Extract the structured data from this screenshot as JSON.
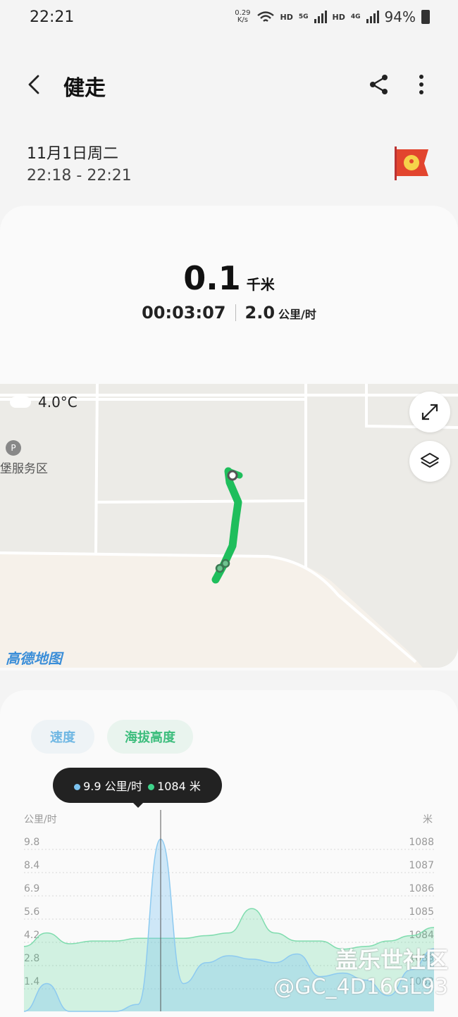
{
  "status": {
    "time": "22:21",
    "net_speed": "0.29",
    "net_unit": "K/s",
    "hd1": "HD",
    "gen1": "5G",
    "hd2": "HD",
    "gen2": "4G",
    "battery": "94%"
  },
  "header": {
    "title": "健走"
  },
  "workout": {
    "date": "11月1日周二",
    "time_range": "22:18 - 22:21",
    "distance": "0.1",
    "distance_unit": "千米",
    "duration": "00:03:07",
    "speed": "2.0",
    "speed_unit": "公里/时"
  },
  "map": {
    "temperature": "4.0°C",
    "poi": "堡服务区",
    "provider": "高德地图"
  },
  "chart_tabs": {
    "speed": "速度",
    "altitude": "海拔高度"
  },
  "tooltip": {
    "speed": "9.9 公里/时",
    "altitude": "1084 米"
  },
  "colors": {
    "speed": "#7cc3f0",
    "altitude": "#3ed38a",
    "route": "#1fbe5c"
  },
  "chart_data": {
    "type": "area",
    "left_axis_label": "公里/时",
    "right_axis_label": "米",
    "left_ticks": [
      "9.8",
      "8.4",
      "6.9",
      "5.6",
      "4.2",
      "2.8",
      "1.4"
    ],
    "right_ticks": [
      "1088",
      "1087",
      "1086",
      "1085",
      "1084",
      "1083",
      "1082"
    ],
    "series": [
      {
        "axis": "left",
        "values": [
          0,
          1.6,
          0,
          0,
          0,
          0.4,
          9.9,
          1.6,
          2.8,
          3.2,
          3.0,
          2.8,
          3.3,
          2.0,
          2.2,
          1.8,
          0.9,
          2.4,
          3.6
        ]
      },
      {
        "axis": "right",
        "values": [
          1084.1,
          1084.6,
          1084.2,
          1084.3,
          1084.3,
          1084.4,
          1084.4,
          1084.4,
          1084.5,
          1084.6,
          1085.5,
          1084.6,
          1084.3,
          1084.3,
          1084.0,
          1084.1,
          1084.3,
          1084.5,
          1084.8
        ]
      }
    ],
    "ylim_left": [
      0,
      9.8
    ],
    "ylim_right": [
      1081.7,
      1088
    ],
    "grid": true
  },
  "watermark": {
    "site": "盖乐世社区",
    "user": "@GC_4D16GL93"
  }
}
